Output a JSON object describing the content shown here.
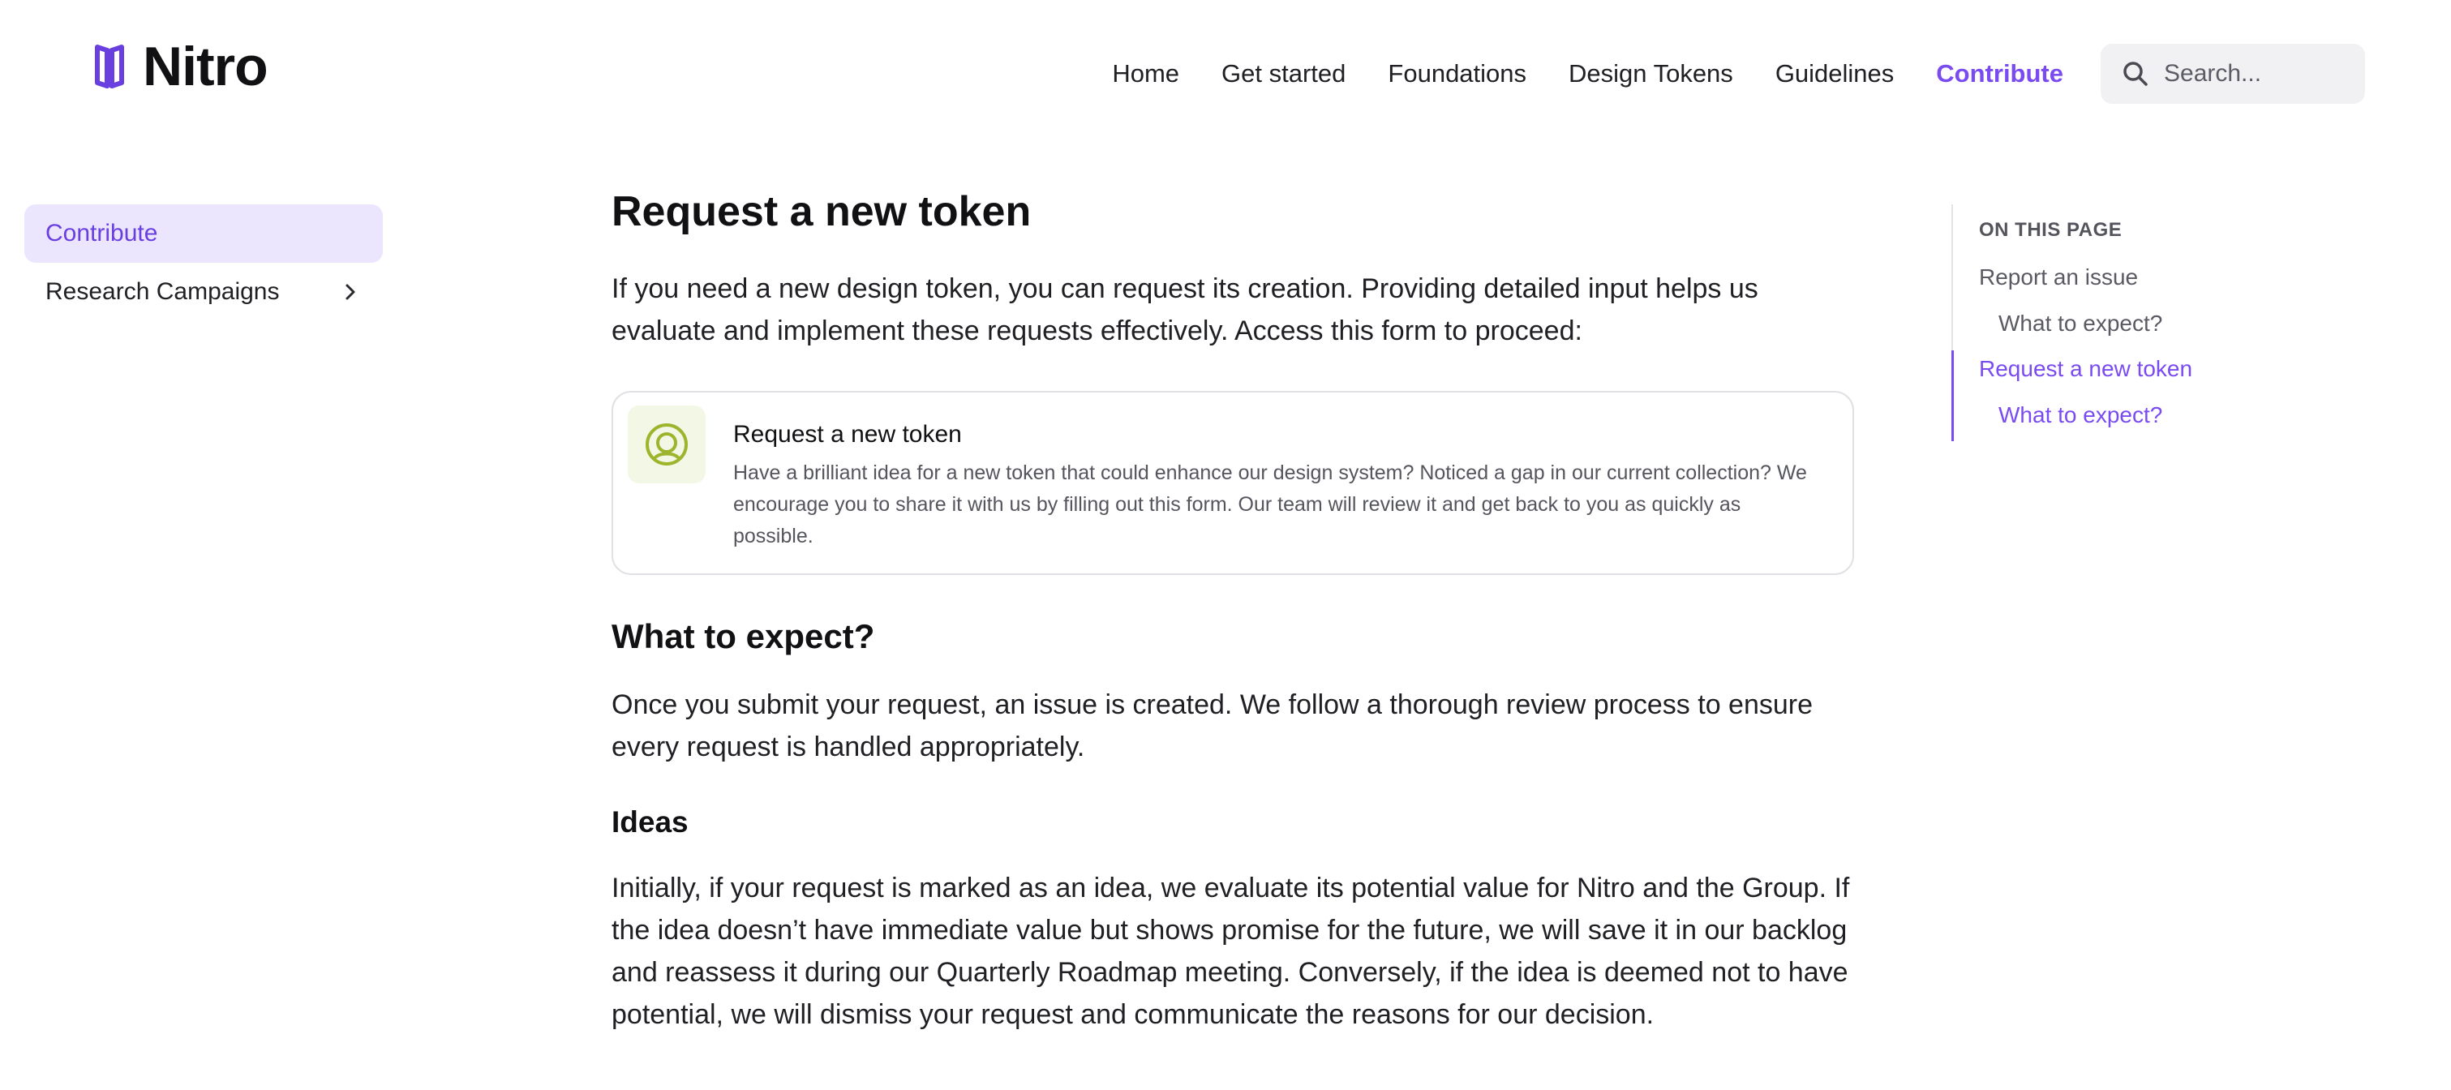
{
  "brand": {
    "name": "Nitro",
    "accent": "#7a4bf0",
    "logo_icon": "nitro-logo-icon"
  },
  "nav": {
    "items": [
      {
        "label": "Home",
        "active": false
      },
      {
        "label": "Get started",
        "active": false
      },
      {
        "label": "Foundations",
        "active": false
      },
      {
        "label": "Design Tokens",
        "active": false
      },
      {
        "label": "Guidelines",
        "active": false
      },
      {
        "label": "Contribute",
        "active": true
      }
    ]
  },
  "search": {
    "placeholder": "Search...",
    "icon": "search-icon"
  },
  "sidebar": {
    "items": [
      {
        "label": "Contribute",
        "active": true
      },
      {
        "label": "Research Campaigns",
        "active": false,
        "icon": "chevron-right-icon"
      }
    ]
  },
  "main": {
    "title": "Request a new token",
    "intro": "If you need a new design token, you can request its creation. Providing detailed input helps us evaluate and implement these requests effectively. Access this form to proceed:",
    "card": {
      "icon": "target-icon",
      "title": "Request a new token",
      "description": "Have a brilliant idea for a new token that could enhance our design system? Noticed a gap in our current collection? We encourage you to share it with us by filling out this form. Our team will review it and get back to you as quickly as possible."
    },
    "section_title": "What to expect?",
    "section_text": "Once you submit your request, an issue is created. We follow a thorough review process to ensure every request is handled appropriately.",
    "ideas_title": "Ideas",
    "ideas_text": "Initially, if your request is marked as an idea, we evaluate its potential value for Nitro and the Group. If the idea doesn’t have immediate value but shows promise for the future, we will save it in our backlog and reassess it during our Quarterly Roadmap meeting. Conversely, if the idea is deemed not to have potential, we will dismiss your request and communicate the reasons for our decision."
  },
  "toc": {
    "title": "ON THIS PAGE",
    "links": [
      {
        "label": "Report an issue",
        "level": 1,
        "active": false
      },
      {
        "label": "What to expect?",
        "level": 2,
        "active": false
      },
      {
        "label": "Request a new token",
        "level": 1,
        "active": true
      },
      {
        "label": "What to expect?",
        "level": 2,
        "active": true
      }
    ]
  }
}
